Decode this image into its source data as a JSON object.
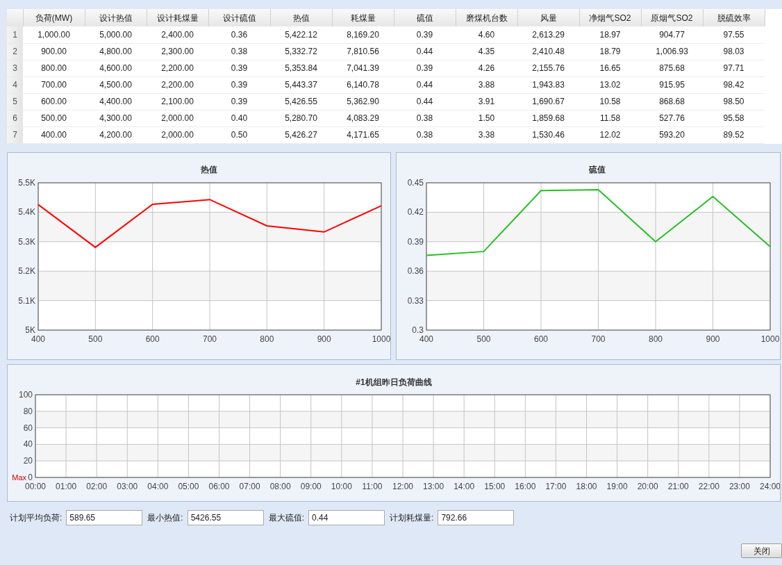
{
  "table": {
    "columns": [
      "负荷(MW)",
      "设计热值",
      "设计耗煤量",
      "设计硫值",
      "热值",
      "耗煤量",
      "硫值",
      "磨煤机台数",
      "风量",
      "净烟气SO2",
      "原烟气SO2",
      "脱硫效率"
    ],
    "rows": [
      {
        "number": "1",
        "cells": [
          "1,000.00",
          "5,000.00",
          "2,400.00",
          "0.36",
          "5,422.12",
          "8,169.20",
          "0.39",
          "4.60",
          "2,613.29",
          "18.97",
          "904.77",
          "97.55"
        ]
      },
      {
        "number": "2",
        "cells": [
          "900.00",
          "4,800.00",
          "2,300.00",
          "0.38",
          "5,332.72",
          "7,810.56",
          "0.44",
          "4.35",
          "2,410.48",
          "18.79",
          "1,006.93",
          "98.03"
        ]
      },
      {
        "number": "3",
        "cells": [
          "800.00",
          "4,600.00",
          "2,200.00",
          "0.39",
          "5,353.84",
          "7,041.39",
          "0.39",
          "4.26",
          "2,155.76",
          "16.65",
          "875.68",
          "97.71"
        ]
      },
      {
        "number": "4",
        "cells": [
          "700.00",
          "4,500.00",
          "2,200.00",
          "0.39",
          "5,443.37",
          "6,140.78",
          "0.44",
          "3.88",
          "1,943.83",
          "13.02",
          "915.95",
          "98.42"
        ]
      },
      {
        "number": "5",
        "cells": [
          "600.00",
          "4,400.00",
          "2,100.00",
          "0.39",
          "5,426.55",
          "5,362.90",
          "0.44",
          "3.91",
          "1,690.67",
          "10.58",
          "868.68",
          "98.50"
        ]
      },
      {
        "number": "6",
        "cells": [
          "500.00",
          "4,300.00",
          "2,000.00",
          "0.40",
          "5,280.70",
          "4,083.29",
          "0.38",
          "1.50",
          "1,859.68",
          "11.58",
          "527.76",
          "95.58"
        ]
      },
      {
        "number": "7",
        "cells": [
          "400.00",
          "4,200.00",
          "2,000.00",
          "0.50",
          "5,426.27",
          "4,171.65",
          "0.38",
          "3.38",
          "1,530.46",
          "12.02",
          "593.20",
          "89.52"
        ]
      }
    ]
  },
  "charts": [
    {
      "chart_data": {
        "type": "line",
        "title": "热值",
        "x": [
          400,
          500,
          600,
          700,
          800,
          900,
          1000
        ],
        "grid": true,
        "series": [
          {
            "color": "#ff0000",
            "values": [
              5426,
              5281,
              5427,
              5443,
              5354,
              5333,
              5422
            ]
          }
        ],
        "xlim": [
          400,
          1000
        ],
        "ylim": [
          5000,
          5500
        ],
        "xticks": [
          400,
          500,
          600,
          700,
          800,
          900,
          1000
        ],
        "yticks": [
          {
            "value": 5000,
            "label": "5K"
          },
          {
            "value": 5100,
            "label": "5.1K"
          },
          {
            "value": 5200,
            "label": "5.2K"
          },
          {
            "value": 5300,
            "label": "5.3K"
          },
          {
            "value": 5400,
            "label": "5.4K"
          },
          {
            "value": 5500,
            "label": "5.5K"
          }
        ]
      }
    },
    {
      "chart_data": {
        "type": "line",
        "title": "硫值",
        "x": [
          400,
          500,
          600,
          700,
          800,
          900,
          1000
        ],
        "grid": true,
        "series": [
          {
            "color": "#22c022",
            "values": [
              0.376,
              0.38,
              0.442,
              0.443,
              0.39,
              0.436,
              0.385
            ]
          }
        ],
        "xlim": [
          400,
          1000
        ],
        "ylim": [
          0.3,
          0.45
        ],
        "xticks": [
          400,
          500,
          600,
          700,
          800,
          900,
          1000
        ],
        "yticks": [
          {
            "value": 0.3,
            "label": "0.3"
          },
          {
            "value": 0.33,
            "label": "0.33"
          },
          {
            "value": 0.36,
            "label": "0.36"
          },
          {
            "value": 0.39,
            "label": "0.39"
          },
          {
            "value": 0.42,
            "label": "0.42"
          },
          {
            "value": 0.45,
            "label": "0.45"
          }
        ]
      }
    }
  ],
  "load_chart": {
    "chart_data": {
      "type": "line",
      "title": "#1机组昨日负荷曲线",
      "categories": [
        "00:00",
        "01:00",
        "02:00",
        "03:00",
        "04:00",
        "05:00",
        "06:00",
        "07:00",
        "08:00",
        "09:00",
        "10:00",
        "11:00",
        "12:00",
        "13:00",
        "14:00",
        "15:00",
        "16:00",
        "17:00",
        "18:00",
        "19:00",
        "20:00",
        "21:00",
        "22:00",
        "23:00",
        "24:00"
      ],
      "grid": true,
      "ylim": [
        0,
        100
      ],
      "yticks": [
        0,
        20,
        40,
        60,
        80,
        100
      ],
      "annotations": [
        "Max"
      ]
    }
  },
  "fields": [
    {
      "label": "计划平均负荷:",
      "value": "589.65"
    },
    {
      "label": "最小热值:",
      "value": "5426.55"
    },
    {
      "label": "最大硫值:",
      "value": "0.44"
    },
    {
      "label": "计划耗煤量:",
      "value": "792.66"
    }
  ],
  "buttons": [
    "关闭"
  ]
}
